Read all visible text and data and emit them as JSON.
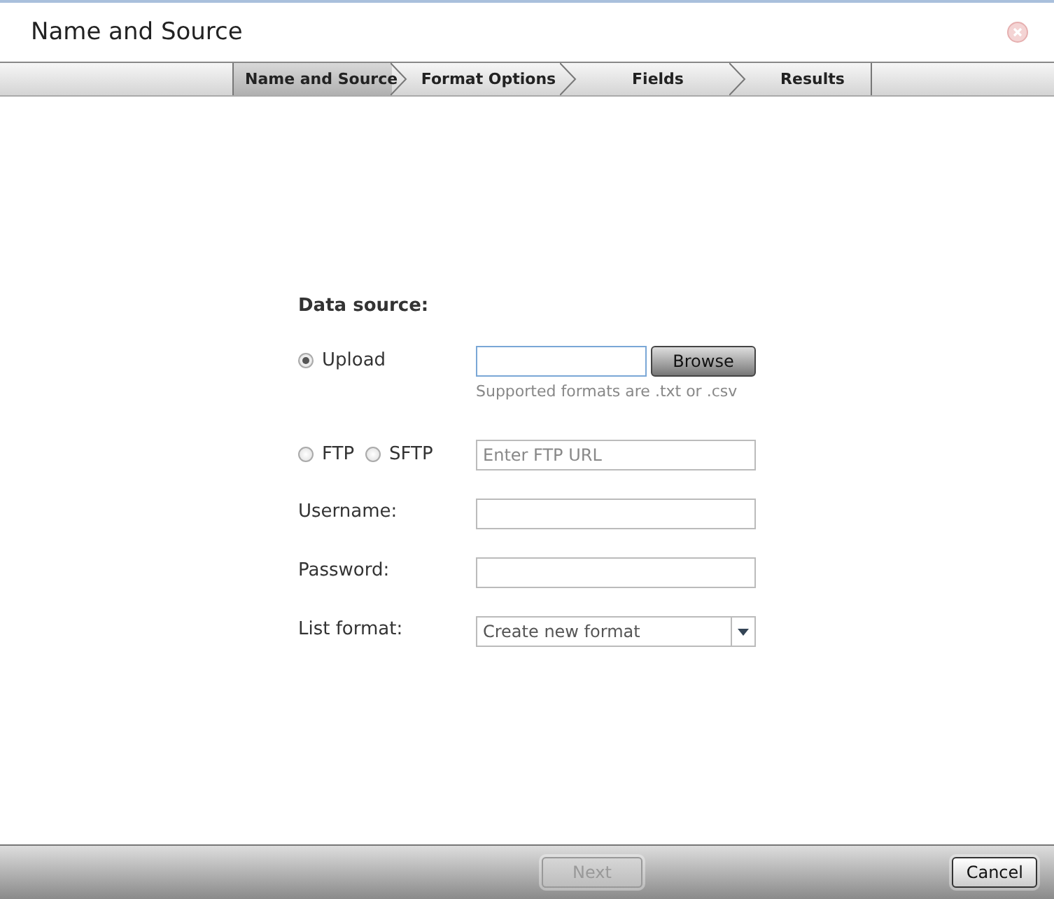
{
  "window": {
    "title": "Name and Source"
  },
  "steps": [
    {
      "label": "Name and Source",
      "selected": true
    },
    {
      "label": "Format Options",
      "selected": false
    },
    {
      "label": "Fields",
      "selected": false
    },
    {
      "label": "Results",
      "selected": false
    }
  ],
  "form": {
    "heading": "Data source:",
    "upload": {
      "label": "Upload",
      "selected": true,
      "button": "Browse",
      "hint": "Supported formats are .txt or .csv"
    },
    "ftp_options": [
      {
        "label": "FTP",
        "selected": false
      },
      {
        "label": "SFTP",
        "selected": false
      }
    ],
    "ftp_url": {
      "placeholder": "Enter FTP URL"
    },
    "username": {
      "label": "Username:"
    },
    "password": {
      "label": "Password:"
    },
    "list_format": {
      "label": "List format:",
      "value": "Create new format"
    }
  },
  "buttons": [
    {
      "label": "Next",
      "disabled": true
    },
    {
      "label": "Cancel",
      "disabled": false
    }
  ]
}
